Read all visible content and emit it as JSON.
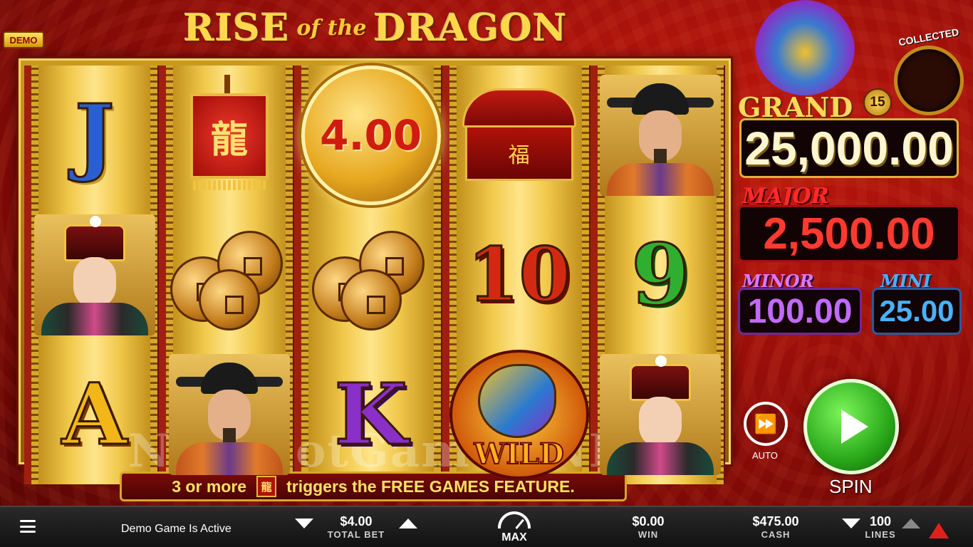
{
  "game": {
    "title_main_1": "RISE",
    "title_small": "of the",
    "title_main_2": "DRAGON",
    "demo_badge": "DEMO"
  },
  "reels": {
    "reel1": {
      "top": "J",
      "middle": "lady",
      "bottom": "A"
    },
    "reel2": {
      "top_banner_char": "龍",
      "middle": "coins",
      "bottom": "official"
    },
    "reel3": {
      "top_coin_value": "4.00",
      "middle": "coins",
      "bottom": "K"
    },
    "reel4": {
      "top_chest_char": "福",
      "middle": "10",
      "bottom_wild": "WILD"
    },
    "reel5": {
      "top": "official",
      "middle": "9",
      "bottom": "lady"
    }
  },
  "feature": {
    "prefix": "3  or more",
    "icon_char": "龍",
    "suffix": "triggers the FREE GAMES FEATURE."
  },
  "jackpots": {
    "collected_label": "COLLECTED",
    "grand_label": "GRAND",
    "grand_badge": "15",
    "grand_value": "25,000.00",
    "major_label": "MAJOR",
    "major_value": "2,500.00",
    "minor_label": "MINOR",
    "minor_value": "100.00",
    "mini_label": "MINI",
    "mini_value": "25.00"
  },
  "controls": {
    "auto_label": "AUTO",
    "spin_label": "SPIN"
  },
  "watermark": "NewSlotGames.NET",
  "bottom_bar": {
    "demo_status": "Demo Game Is Active",
    "total_bet_value": "$4.00",
    "total_bet_label": "TOTAL BET",
    "max_label": "MAX",
    "win_value": "$0.00",
    "win_label": "WIN",
    "cash_value": "$475.00",
    "cash_label": "CASH",
    "lines_value": "100",
    "lines_label": "LINES"
  },
  "colors": {
    "background_red": "#b0140c",
    "gold": "#ffd95a",
    "spin_green": "#2aa81a"
  }
}
